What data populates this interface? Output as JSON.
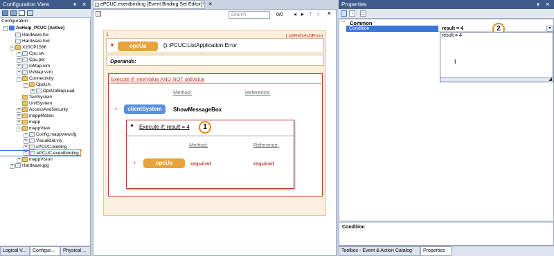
{
  "config_view": {
    "title": "Configuration View",
    "caption": "Configuration",
    "tree": [
      {
        "label": "AsHelp_PCUC [Active]",
        "bold": true
      },
      {
        "label": "Hardware.hw"
      },
      {
        "label": "Hardware.hwl"
      },
      {
        "label": "X20CP1586"
      },
      {
        "label": "Cpu.sw"
      },
      {
        "label": "Cpu.per"
      },
      {
        "label": "IoMap.iom"
      },
      {
        "label": "PvMap.vvm"
      },
      {
        "label": "Connectivity"
      },
      {
        "label": "OpcUA"
      },
      {
        "label": "OpcUaMap.uad"
      },
      {
        "label": "TextSystem"
      },
      {
        "label": "UnitSystem"
      },
      {
        "label": "AccessAndSecurity"
      },
      {
        "label": "mappMotion"
      },
      {
        "label": "mapp"
      },
      {
        "label": "mappView"
      },
      {
        "label": "Config.mappviewcfg"
      },
      {
        "label": "Visualizat.vis"
      },
      {
        "label": "cPCUC.binding"
      },
      {
        "label": "ePCUC.eventbinding"
      },
      {
        "label": "mappVision"
      },
      {
        "label": "Hardware.jpg"
      }
    ],
    "bottom_tabs": [
      "Logical V...",
      "Configur...",
      "Physical ..."
    ]
  },
  "editor": {
    "tab_title": "ePCUC.eventbinding [Event Binding Set Editor]*",
    "search_placeholder": "Search",
    "search_count": "0/0",
    "event_index": "1",
    "event_name": "ListRefreshError",
    "source_pill": "opcUa",
    "source_path": "()::PCUC:ListApplication.Error",
    "operands_label": "Operands:",
    "condition_outer": "Execute if: newValue AND NOT oldValue",
    "method_header": "Method:",
    "reference_header": "Reference:",
    "action_pill": "clientSystem",
    "action_method": "ShowMessageBox",
    "condition_inner": "Execute if: result = 4",
    "inner_pill": "opcUa",
    "required_method": "required",
    "required_reference": "required",
    "badge_1": "1"
  },
  "properties": {
    "title": "Properties",
    "category": "Common",
    "row_label": "Condition",
    "row_value": "result = 4",
    "editor_text": "result = 4",
    "description_title": "Condition",
    "badge_2": "2",
    "bottom_tabs": [
      "Toolbox - Event & Action Catalog",
      "Properties"
    ]
  },
  "colors": {
    "title_bar": "#3f5b8a",
    "orange": "#e8a33c",
    "blue_pill": "#5b8fe0",
    "red": "#c0392b",
    "selection": "#3a74d8"
  }
}
